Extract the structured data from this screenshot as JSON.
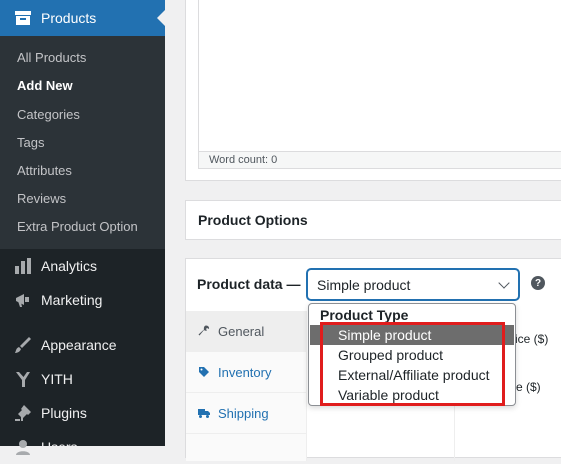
{
  "sidebar": {
    "header": {
      "label": "Products",
      "icon": "archive-icon"
    },
    "submenu": [
      {
        "label": "All Products",
        "current": false
      },
      {
        "label": "Add New",
        "current": true
      },
      {
        "label": "Categories",
        "current": false
      },
      {
        "label": "Tags",
        "current": false
      },
      {
        "label": "Attributes",
        "current": false
      },
      {
        "label": "Reviews",
        "current": false
      },
      {
        "label": "Extra Product Option",
        "current": false
      }
    ],
    "menu": [
      {
        "label": "Analytics",
        "icon": "bar-chart-icon"
      },
      {
        "label": "Marketing",
        "icon": "megaphone-icon"
      },
      {
        "label": "Appearance",
        "icon": "paintbrush-icon"
      },
      {
        "label": "YITH",
        "icon": "yith-logo-icon"
      },
      {
        "label": "Plugins",
        "icon": "plugin-icon"
      },
      {
        "label": "Users",
        "icon": "users-icon"
      }
    ]
  },
  "editor": {
    "word_count": "Word count: 0"
  },
  "product_options": {
    "title": "Product Options"
  },
  "product_data": {
    "label": "Product data —",
    "type_select_value": "Simple product",
    "help_icon": "?",
    "tabs": [
      {
        "label": "General",
        "icon": "wrench-icon",
        "active": true
      },
      {
        "label": "Inventory",
        "icon": "tag-icon",
        "active": false
      },
      {
        "label": "Shipping",
        "icon": "truck-icon",
        "active": false
      }
    ],
    "partial_labels": {
      "regular_price": "rice ($)",
      "sale_price": "e ($)"
    }
  },
  "dropdown": {
    "group_label": "Product Type",
    "options": [
      {
        "label": "Simple product",
        "selected": true
      },
      {
        "label": "Grouped product",
        "selected": false
      },
      {
        "label": "External/Affiliate product",
        "selected": false
      },
      {
        "label": "Variable product",
        "selected": false
      }
    ]
  },
  "colors": {
    "sidebar_bg": "#1d2327",
    "submenu_bg": "#2c3338",
    "accent": "#2271b1",
    "highlight": "#e01c1c",
    "selected_option_bg": "#6d6d6d"
  }
}
